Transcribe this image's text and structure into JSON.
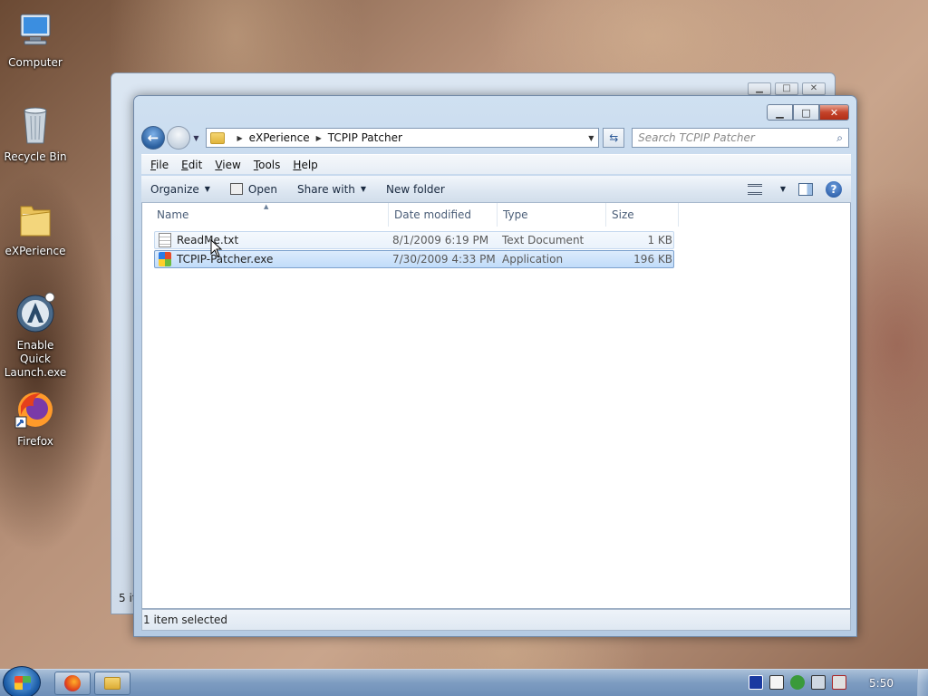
{
  "desktop": {
    "icons": [
      {
        "label": "Computer",
        "icon": "computer-icon"
      },
      {
        "label": "Recycle Bin",
        "icon": "recycle-bin-icon"
      },
      {
        "label": "eXPerience",
        "icon": "folder-icon"
      },
      {
        "label": "Enable Quick Launch.exe",
        "icon": "quick-launch-icon"
      },
      {
        "label": "Firefox",
        "icon": "firefox-icon"
      }
    ]
  },
  "back_window": {
    "status": "5 it"
  },
  "window": {
    "breadcrumb": [
      "eXPerience",
      "TCPIP Patcher"
    ],
    "search_placeholder": "Search TCPIP Patcher",
    "menu": [
      "File",
      "Edit",
      "View",
      "Tools",
      "Help"
    ],
    "menu_hotkeys": [
      "F",
      "E",
      "V",
      "T",
      "H"
    ],
    "toolbar": {
      "organize": "Organize",
      "open": "Open",
      "share_with": "Share with",
      "new_folder": "New folder"
    },
    "columns": {
      "name": "Name",
      "date": "Date modified",
      "type": "Type",
      "size": "Size"
    },
    "files": [
      {
        "name": "ReadMe.txt",
        "date": "8/1/2009 6:19 PM",
        "type": "Text Document",
        "size": "1 KB"
      },
      {
        "name": "TCPIP-Patcher.exe",
        "date": "7/30/2009 4:33 PM",
        "type": "Application",
        "size": "196 KB"
      }
    ],
    "status": "1 item selected"
  },
  "taskbar": {
    "clock": "5:50"
  },
  "colors": {
    "selection": "#c1dcfa",
    "accent": "#2a5f9e"
  }
}
